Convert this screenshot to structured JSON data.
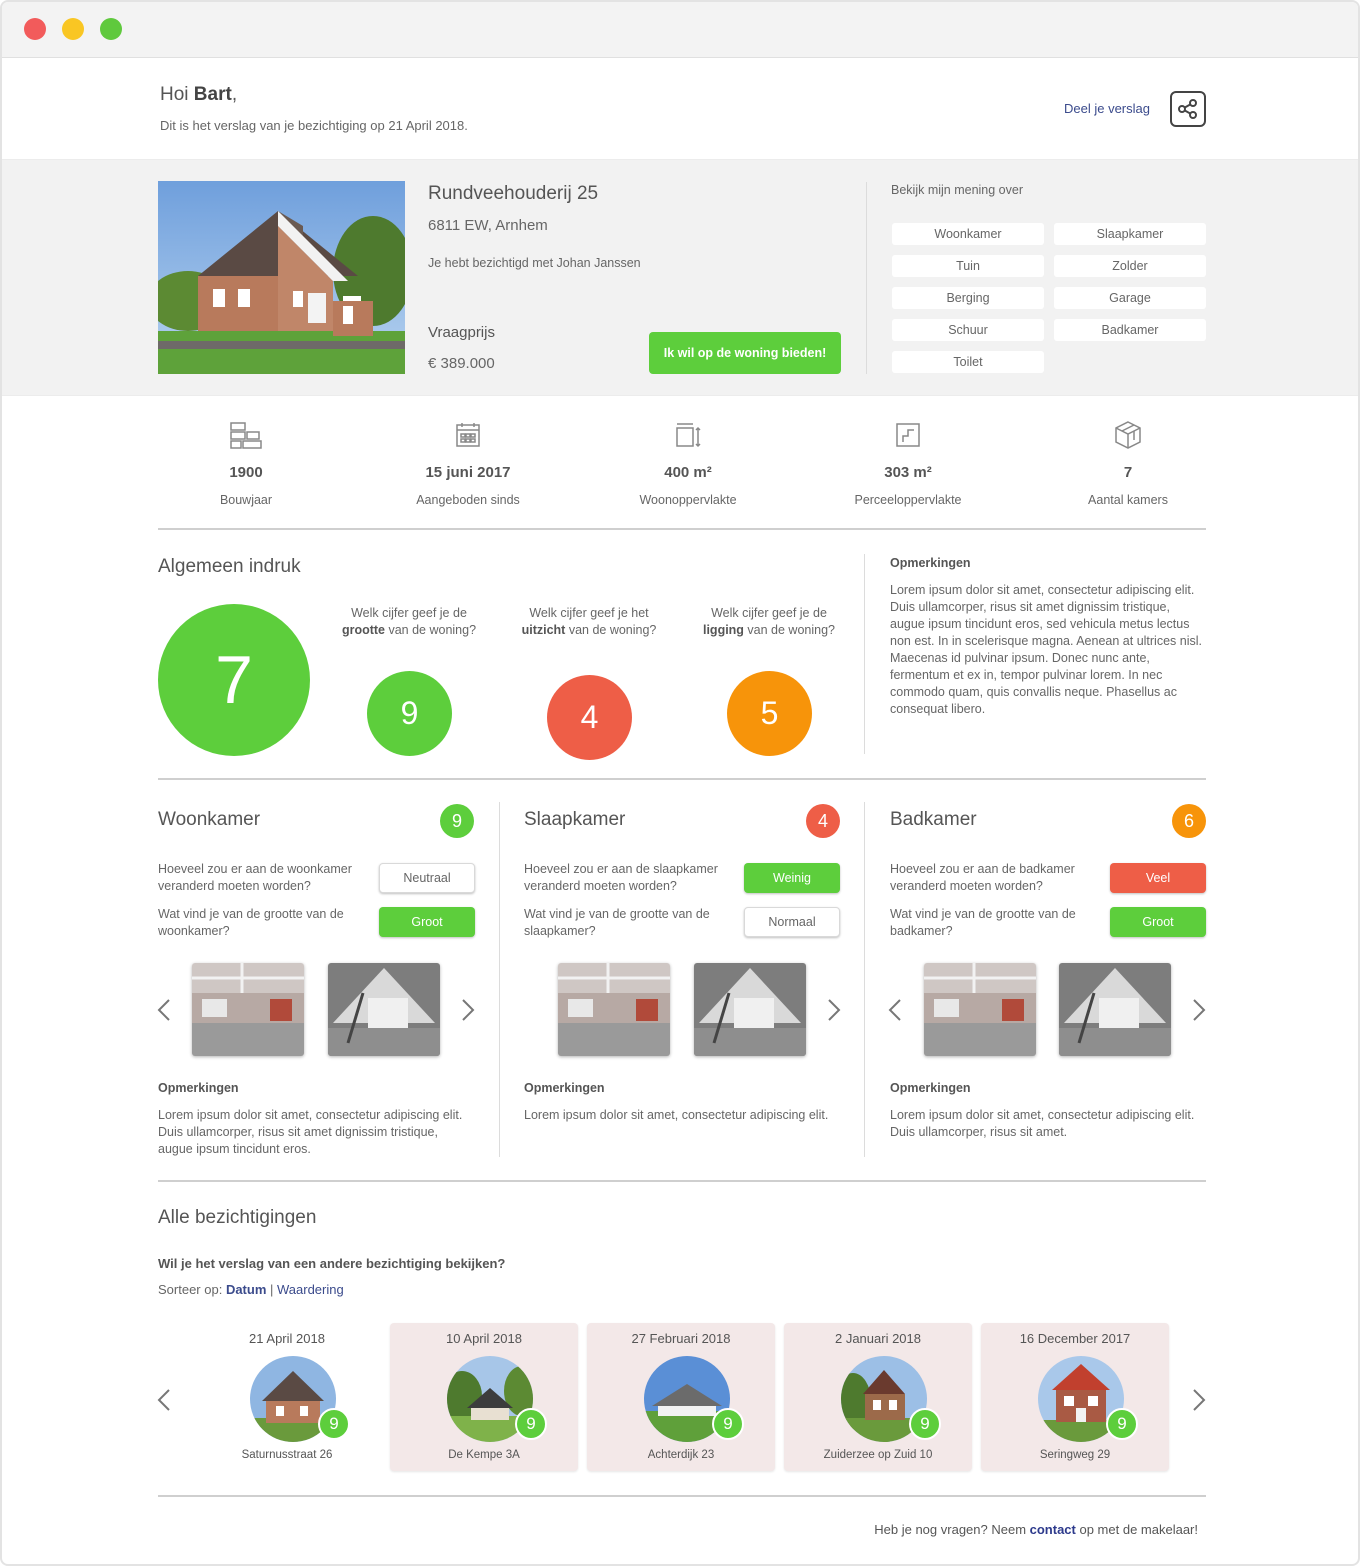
{
  "header": {
    "greeting_prefix": "Hoi ",
    "user_name": "Bart",
    "greeting_suffix": ",",
    "subtitle": "Dit is het verslag van je bezichtiging op 21 April 2018.",
    "share_label": "Deel je verslag",
    "share_icon": "share-icon"
  },
  "property": {
    "address": "Rundveehouderij 25",
    "zip_city": "6811 EW, Arnhem",
    "viewed_with": "Je hebt bezichtigd met Johan Janssen",
    "price_label": "Vraagprijs",
    "price": "€ 389.000",
    "bid_button": "Ik wil op de woning bieden!"
  },
  "opinion": {
    "title": "Bekijk mijn mening over",
    "rooms": [
      "Woonkamer",
      "Slaapkamer",
      "Tuin",
      "Zolder",
      "Berging",
      "Garage",
      "Schuur",
      "Badkamer",
      "Toilet"
    ]
  },
  "stats": [
    {
      "icon": "bricks-icon",
      "value": "1900",
      "label": "Bouwjaar"
    },
    {
      "icon": "calendar-icon",
      "value": "15 juni 2017",
      "label": "Aangeboden sinds"
    },
    {
      "icon": "floor-area-icon",
      "value": "400 m²",
      "label": "Woonoppervlakte"
    },
    {
      "icon": "plot-icon",
      "value": "303 m²",
      "label": "Perceeloppervlakte"
    },
    {
      "icon": "cube-icon",
      "value": "7",
      "label": "Aantal kamers"
    }
  ],
  "overall": {
    "title": "Algemeen indruk",
    "score": "7",
    "questions": [
      {
        "pre": "Welk cijfer geef je de",
        "bold": "grootte",
        "post": " van de woning?",
        "score": "9"
      },
      {
        "pre": "Welk cijfer geef je het",
        "bold": "uitzicht",
        "post": " van de woning?",
        "score": "4"
      },
      {
        "pre": "Welk cijfer geef je de",
        "bold": "ligging",
        "post": " van de woning?",
        "score": "5"
      }
    ],
    "remarks_title": "Opmerkingen",
    "remarks": "Lorem ipsum dolor sit amet, consectetur adipiscing elit. Duis ullamcorper, risus sit amet dignissim tristique, augue ipsum tincidunt eros, sed vehicula metus lectus non est. In in scelerisque magna. Aenean at ultrices nisl. Maecenas id pulvinar ipsum. Donec nunc ante, fermentum et ex in, tempor pulvinar lorem. In nec commodo quam, quis convallis neque. Phasellus ac consequat libero."
  },
  "rooms": [
    {
      "title": "Woonkamer",
      "score": "9",
      "q1": "Hoeveel zou er aan de woonkamer veranderd moeten worden?",
      "a1": "Neutraal",
      "q2": "Wat vind je van de grootte van de woonkamer?",
      "a2": "Groot",
      "remarks_title": "Opmerkingen",
      "remarks": "Lorem ipsum dolor sit amet, consectetur adipiscing elit. Duis ullamcorper, risus sit amet dignissim tristique, augue ipsum tincidunt eros."
    },
    {
      "title": "Slaapkamer",
      "score": "4",
      "q1": "Hoeveel zou er aan de slaapkamer veranderd moeten worden?",
      "a1": "Weinig",
      "q2": "Wat vind je van de grootte van de slaapkamer?",
      "a2": "Normaal",
      "remarks_title": "Opmerkingen",
      "remarks": "Lorem ipsum dolor sit amet, consectetur adipiscing elit."
    },
    {
      "title": "Badkamer",
      "score": "6",
      "q1": "Hoeveel zou er aan de badkamer  veranderd moeten worden?",
      "a1": "Veel",
      "q2": "Wat vind je van de grootte van de badkamer?",
      "a2": "Groot",
      "remarks_title": "Opmerkingen",
      "remarks": "Lorem ipsum dolor sit amet, consectetur adipiscing elit. Duis ullamcorper, risus sit amet."
    }
  ],
  "viewings": {
    "title": "Alle bezichtigingen",
    "question": "Wil je het verslag van een andere bezichtiging bekijken?",
    "sort_prefix": "Sorteer op: ",
    "sort_date": "Datum",
    "sort_sep": " | ",
    "sort_rating": "Waardering",
    "items": [
      {
        "date": "21 April 2018",
        "score": "9",
        "name": "Saturnusstraat 26"
      },
      {
        "date": "10 April 2018",
        "score": "9",
        "name": "De Kempe 3A"
      },
      {
        "date": "27 Februari 2018",
        "score": "9",
        "name": "Achterdijk 23"
      },
      {
        "date": "2 Januari 2018",
        "score": "9",
        "name": "Zuiderzee op Zuid 10"
      },
      {
        "date": "16 December 2017",
        "score": "9",
        "name": "Seringweg 29"
      }
    ]
  },
  "footer": {
    "prefix": "Heb je nog vragen? Neem ",
    "link": "contact",
    "suffix": " op met de makelaar!"
  },
  "colors": {
    "green": "#5dce3c",
    "red": "#ee5e47",
    "orange": "#f7940a",
    "link": "#3b4b8c"
  }
}
